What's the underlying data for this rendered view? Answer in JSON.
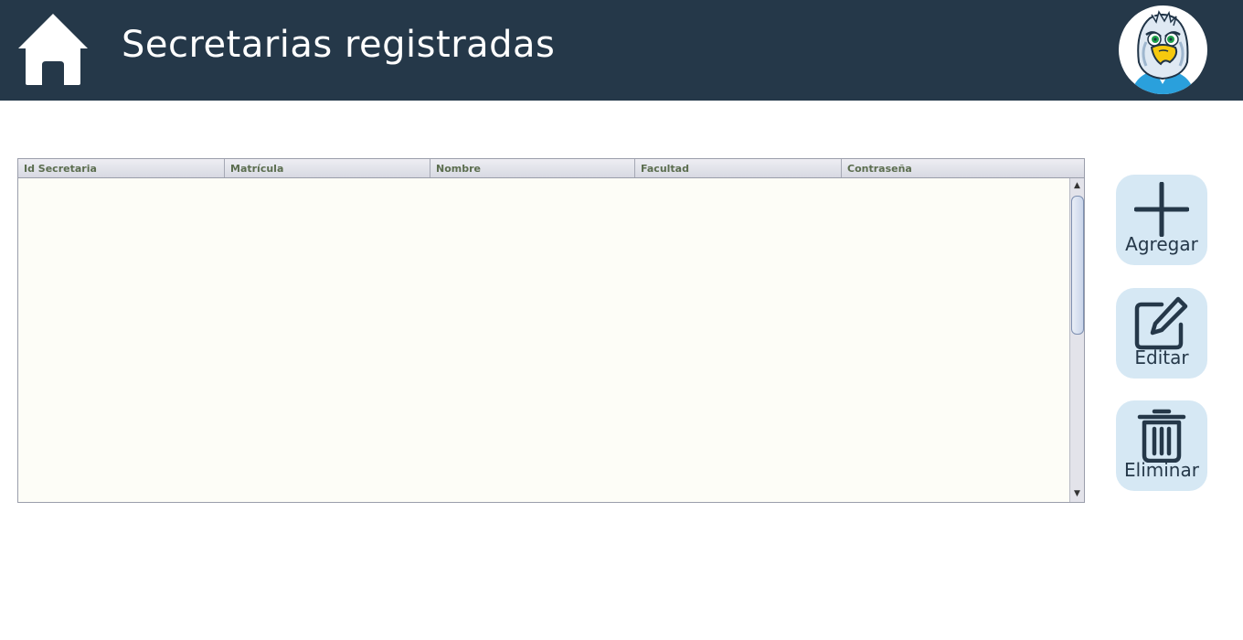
{
  "header": {
    "title": "Secretarias registradas",
    "home_icon": "home-icon",
    "avatar_icon": "eagle-mascot-avatar",
    "background": "#253849"
  },
  "table": {
    "columns": [
      "Id Secretaria",
      "Matrícula",
      "Nombre",
      "Facultad",
      "Contraseña"
    ],
    "rows": []
  },
  "actions": {
    "add_label": "Agregar",
    "edit_label": "Editar",
    "delete_label": "Eliminar",
    "button_color": "#d6e8f4",
    "icon_color": "#253849"
  }
}
